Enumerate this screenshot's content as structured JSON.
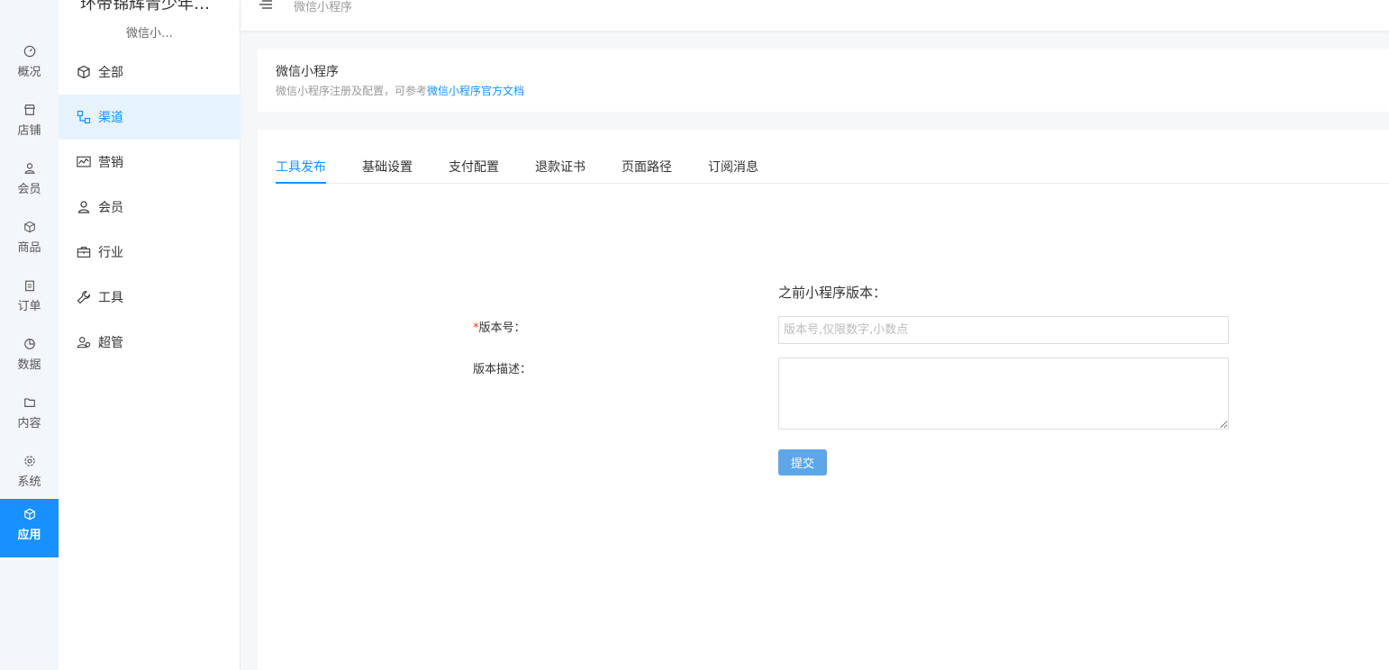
{
  "rail": {
    "items": [
      {
        "label": "概况",
        "icon": "dashboard-icon"
      },
      {
        "label": "店铺",
        "icon": "store-icon"
      },
      {
        "label": "会员",
        "icon": "user-icon"
      },
      {
        "label": "商品",
        "icon": "cube-icon"
      },
      {
        "label": "订单",
        "icon": "clipboard-icon"
      },
      {
        "label": "数据",
        "icon": "pie-chart-icon"
      },
      {
        "label": "内容",
        "icon": "folder-icon"
      },
      {
        "label": "系统",
        "icon": "gear-icon"
      },
      {
        "label": "应用",
        "icon": "app-icon",
        "active": true
      }
    ]
  },
  "sidebar": {
    "shop_title": "环帝锦辉青少年…",
    "shop_sub": "微信小…",
    "items": [
      {
        "label": "全部",
        "icon": "cube-icon"
      },
      {
        "label": "渠道",
        "icon": "channel-icon",
        "active": true
      },
      {
        "label": "营销",
        "icon": "marketing-chart-icon"
      },
      {
        "label": "会员",
        "icon": "user-icon"
      },
      {
        "label": "行业",
        "icon": "briefcase-icon"
      },
      {
        "label": "工具",
        "icon": "wrench-icon"
      },
      {
        "label": "超管",
        "icon": "admin-users-icon"
      }
    ]
  },
  "topbar": {
    "breadcrumb": "微信小程序"
  },
  "header": {
    "title": "微信小程序",
    "desc_prefix": "微信小程序注册及配置，可参考",
    "desc_link": "微信小程序官方文档"
  },
  "tabs": [
    {
      "label": "工具发布",
      "active": true
    },
    {
      "label": "基础设置"
    },
    {
      "label": "支付配置"
    },
    {
      "label": "退款证书"
    },
    {
      "label": "页面路径"
    },
    {
      "label": "订阅消息"
    }
  ],
  "form": {
    "prev_version_label": "之前小程序版本：",
    "version_required_mark": "*",
    "version_label": "版本号：",
    "version_placeholder": "版本号,仅限数字,小数点",
    "desc_label": "版本描述：",
    "submit_label": "提交"
  },
  "colors": {
    "accent": "#1890ff",
    "submit": "#5da7e8"
  }
}
